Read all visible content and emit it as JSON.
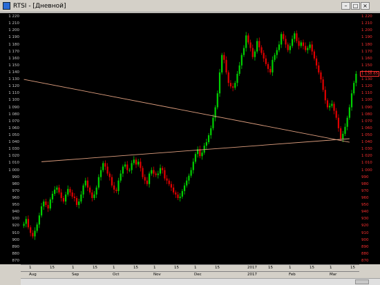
{
  "window": {
    "title": "RTSI - [Дневной]",
    "buttons": [
      "–",
      "□",
      "×"
    ]
  },
  "axis": {
    "ticks": [
      "1 220",
      "1 210",
      "1 200",
      "1 190",
      "1 180",
      "1 170",
      "1 160",
      "1 150",
      "1 140",
      "1 130",
      "1 120",
      "1 110",
      "1 100",
      "1 090",
      "1 080",
      "1 070",
      "1 060",
      "1 050",
      "1 040",
      "1 030",
      "1 020",
      "1 010",
      "1 000",
      "990",
      "980",
      "970",
      "960",
      "950",
      "940",
      "930",
      "920",
      "910",
      "900",
      "890",
      "880",
      "870"
    ],
    "last_price": "1 138.65"
  },
  "dates": {
    "row1": [
      "1",
      "15",
      "1",
      "15",
      "1",
      "15",
      "1",
      "15",
      "1",
      "15",
      "2017",
      "15",
      "1",
      "15",
      "1",
      "15"
    ],
    "row2": [
      "Aug",
      "Sep",
      "Oct",
      "Nov",
      "Dec",
      "2017",
      "Feb",
      "Mar"
    ]
  },
  "colors": {
    "up": "#00d000",
    "down": "#e00000",
    "trend": "#e0a080",
    "background": "#000000"
  },
  "chart_data": {
    "type": "candlestick",
    "title": "",
    "ylim": [
      865,
      1225
    ],
    "trendlines": [
      {
        "from": [
          0,
          1130
        ],
        "to": [
          148,
          1040
        ]
      },
      {
        "from": [
          8,
          1012
        ],
        "to": [
          148,
          1045
        ]
      }
    ],
    "closes": [
      923,
      930,
      918,
      910,
      905,
      913,
      922,
      935,
      948,
      955,
      950,
      945,
      958,
      966,
      972,
      975,
      968,
      960,
      955,
      965,
      973,
      968,
      962,
      960,
      950,
      955,
      965,
      978,
      985,
      975,
      968,
      960,
      965,
      975,
      990,
      1000,
      1010,
      1005,
      995,
      990,
      978,
      972,
      970,
      985,
      995,
      1005,
      1008,
      1000,
      1000,
      1010,
      1015,
      1008,
      1012,
      1003,
      990,
      985,
      980,
      995,
      1000,
      995,
      993,
      995,
      1003,
      1000,
      988,
      985,
      980,
      975,
      968,
      965,
      960,
      962,
      970,
      978,
      985,
      992,
      1000,
      1012,
      1023,
      1030,
      1020,
      1025,
      1035,
      1040,
      1050,
      1060,
      1075,
      1090,
      1110,
      1140,
      1165,
      1158,
      1140,
      1125,
      1120,
      1118,
      1125,
      1138,
      1150,
      1165,
      1175,
      1193,
      1183,
      1175,
      1162,
      1170,
      1185,
      1176,
      1168,
      1160,
      1152,
      1145,
      1140,
      1158,
      1165,
      1172,
      1180,
      1195,
      1188,
      1180,
      1172,
      1178,
      1188,
      1196,
      1185,
      1178,
      1183,
      1178,
      1172,
      1175,
      1180,
      1170,
      1160,
      1150,
      1140,
      1130,
      1115,
      1100,
      1090,
      1092,
      1095,
      1085,
      1075,
      1060,
      1045,
      1052,
      1062,
      1075,
      1090,
      1110,
      1125,
      1138
    ]
  }
}
